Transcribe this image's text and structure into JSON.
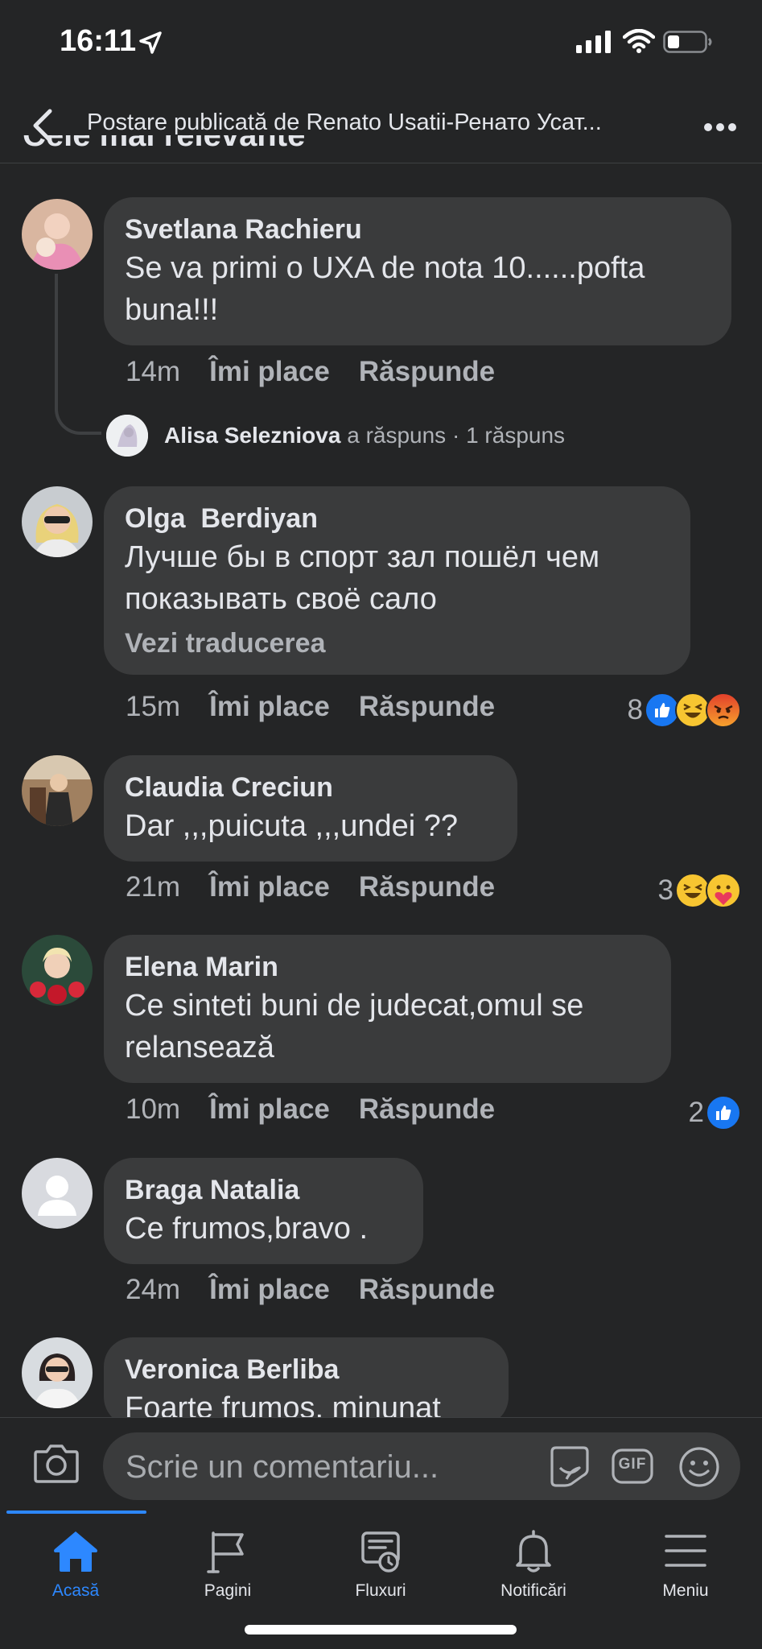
{
  "status_bar": {
    "time": "16:11"
  },
  "header": {
    "title": "Postare publicată de Renato Usatii-Ренато Усат..."
  },
  "section_partial": "Cele mai relevante",
  "actions": {
    "like": "Îmi place",
    "reply": "Răspunde"
  },
  "comments": [
    {
      "author": "Svetlana Rachieru",
      "text": "Se va primi o UXA de nota 10......pofta buna!!!",
      "time": "14m",
      "reply_summary": {
        "name": "Alisa Selezniova",
        "verb": "a răspuns",
        "count_text": "· 1 răspuns"
      }
    },
    {
      "author": "Olga  Berdiyan",
      "text": "Лучше бы в спорт зал пошёл чем показывать своё сало",
      "translate": "Vezi traducerea",
      "time": "15m",
      "reaction_count": "8",
      "reactions": [
        "like",
        "haha",
        "angry"
      ]
    },
    {
      "author": "Claudia Creciun",
      "text": "Dar ,,,puicuta ,,,undei ??",
      "time": "21m",
      "reaction_count": "3",
      "reactions": [
        "haha",
        "care"
      ]
    },
    {
      "author": "Elena Marin",
      "text": "Ce sinteti buni de judecat,omul se relansează",
      "time": "10m",
      "reaction_count": "2",
      "reactions": [
        "like"
      ]
    },
    {
      "author": "Braga Natalia",
      "text": "Ce frumos,bravo .",
      "time": "24m"
    },
    {
      "author": "Veronica Berliba",
      "text": "Foarte frumos, minunat"
    }
  ],
  "composer": {
    "placeholder": "Scrie un comentariu...",
    "gif_label": "GIF"
  },
  "tabs": [
    {
      "label": "Acasă",
      "icon": "home-icon",
      "active": true
    },
    {
      "label": "Pagini",
      "icon": "flag-icon"
    },
    {
      "label": "Fluxuri",
      "icon": "feeds-icon"
    },
    {
      "label": "Notificări",
      "icon": "bell-icon"
    },
    {
      "label": "Meniu",
      "icon": "menu-icon"
    }
  ],
  "colors": {
    "background": "#242526",
    "bubble": "#3a3b3c",
    "accent": "#2d88ff",
    "secondary_text": "#b0b3b8"
  }
}
